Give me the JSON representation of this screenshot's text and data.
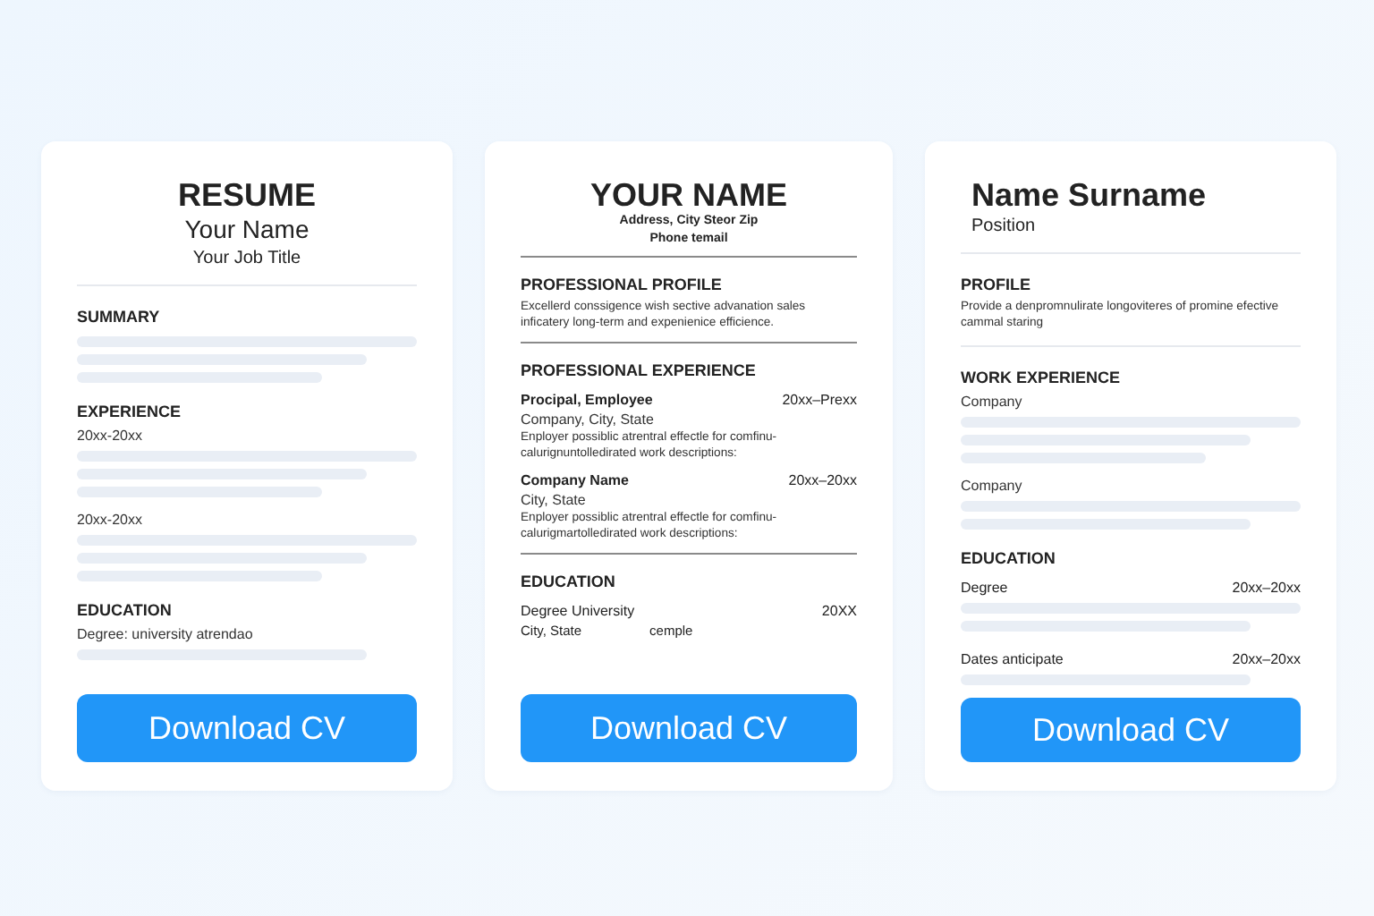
{
  "cards": [
    {
      "kind": "centered",
      "blocks": [
        {
          "kind": "title",
          "text": "RESUME"
        },
        {
          "kind": "subtitle",
          "text": "Your Name"
        },
        {
          "kind": "caption",
          "text": "Your Job Title"
        },
        {
          "kind": "rule"
        },
        {
          "kind": "heading",
          "text": "SUMMARY"
        },
        {
          "kind": "threelines"
        },
        {
          "kind": "heading",
          "text": "EXPERIENCE"
        },
        {
          "kind": "label",
          "text": "20xx-20xx"
        },
        {
          "kind": "threelines"
        },
        {
          "kind": "label",
          "text": "20xx-20xx"
        },
        {
          "kind": "threelines"
        },
        {
          "kind": "heading",
          "text": "EDUCATION"
        },
        {
          "kind": "label",
          "text": "Degree: university atrendao"
        },
        {
          "kind": "oneline"
        }
      ],
      "button": "Download CV"
    },
    {
      "kind": "centered",
      "blocks": [
        {
          "kind": "title",
          "text": "YOUR NAME"
        },
        {
          "kind": "contact",
          "text": "Address, City Steor Zip"
        },
        {
          "kind": "contact",
          "text": "Phone temail"
        },
        {
          "kind": "divider"
        },
        {
          "kind": "heading",
          "text": "PROFESSIONAL PROFILE"
        },
        {
          "kind": "paragraph",
          "text": "Excellerd conssigence wish sective advanation sales inficatery long-term and expenienice efficience."
        },
        {
          "kind": "divider"
        },
        {
          "kind": "heading",
          "text": "PROFESSIONAL EXPERIENCE"
        },
        {
          "kind": "pair",
          "left": "Procipal, Employee",
          "right": "20xx–Prexx",
          "strong": true
        },
        {
          "kind": "label",
          "text": "Company, City, State"
        },
        {
          "kind": "paragraph",
          "text": "Enployer possiblic atrentral effectle for comfinu-calurignuntolledirated work descriptions:"
        },
        {
          "kind": "pair",
          "left": "Company Name",
          "right": "20xx–20xx",
          "strong": true
        },
        {
          "kind": "label",
          "text": "City, State"
        },
        {
          "kind": "paragraph",
          "text": "Enployer possiblic atrentral effectle for comfinu-calurigmartolledirated work descriptions:"
        },
        {
          "kind": "divider"
        },
        {
          "kind": "heading",
          "text": "EDUCATION"
        },
        {
          "kind": "pair",
          "left": "Degree University",
          "right": "20XX",
          "strong": false
        },
        {
          "kind": "inline",
          "left": "City, State",
          "right": "cemple"
        }
      ],
      "button": "Download CV"
    },
    {
      "kind": "left",
      "blocks": [
        {
          "kind": "title",
          "text": "Name Surname"
        },
        {
          "kind": "caption",
          "text": "Position"
        },
        {
          "kind": "rule"
        },
        {
          "kind": "heading",
          "text": "PROFILE"
        },
        {
          "kind": "paragraph",
          "text": "Provide a denpromnulirate longoviteres of promine efective cammal staring"
        },
        {
          "kind": "rule"
        },
        {
          "kind": "heading",
          "text": "WORK EXPERIENCE"
        },
        {
          "kind": "label",
          "text": "Company"
        },
        {
          "kind": "threelines"
        },
        {
          "kind": "label",
          "text": "Company"
        },
        {
          "kind": "twolines"
        },
        {
          "kind": "heading",
          "text": "EDUCATION"
        },
        {
          "kind": "pair",
          "left": "Degree",
          "right": "20xx–20xx",
          "strong": false
        },
        {
          "kind": "twolines"
        },
        {
          "kind": "pair",
          "left": "Dates anticipate",
          "right": "20xx–20xx",
          "strong": false
        },
        {
          "kind": "oneline"
        }
      ],
      "button": "Download CV"
    }
  ]
}
